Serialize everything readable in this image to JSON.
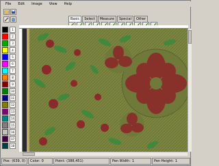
{
  "menu": [
    "File",
    "Edit",
    "Image",
    "View",
    "Help"
  ],
  "tabs": [
    "Basic",
    "Select",
    "Measure",
    "Special",
    "Other"
  ],
  "active_tab": 0,
  "icons": [
    "pencil-icon",
    "check-icon",
    "check-icon",
    "check-icon",
    "check-icon",
    "check-icon",
    "check-icon",
    "check-icon",
    "check-icon",
    "check-icon",
    "check-icon"
  ],
  "palette": {
    "colors": [
      "#000000",
      "#ff0000",
      "#00aa00",
      "#ffff00",
      "#0000ff",
      "#ff00ff",
      "#00ffff",
      "#ff8000",
      "#800000",
      "#008000",
      "#000080",
      "#808000",
      "#800080",
      "#008080",
      "#808080",
      "#c0c0c0",
      "#400040",
      "#004040"
    ],
    "labels": [
      "1",
      "2",
      "3",
      "4",
      "5",
      "6",
      "7",
      "8",
      "9",
      "10",
      "11",
      "12",
      "13",
      "14",
      "15",
      "16",
      "17",
      "18"
    ]
  },
  "status": {
    "pos_label": "Pos:",
    "pos_value": "(639, 0)",
    "color_label": "Color:",
    "color_value": "0",
    "point_label": "Point:",
    "point_value": "(388,451)",
    "pen_width_label": "Pen Width:",
    "pen_width_value": "1",
    "pen_height_label": "Pen Height:",
    "pen_height_value": "1"
  },
  "colors": {
    "canvas_bg": "#7c8640",
    "flower_red": "#8b2a2a",
    "leaf_green": "#3d8a3d",
    "stripe_dark": "#2b2b2b"
  }
}
